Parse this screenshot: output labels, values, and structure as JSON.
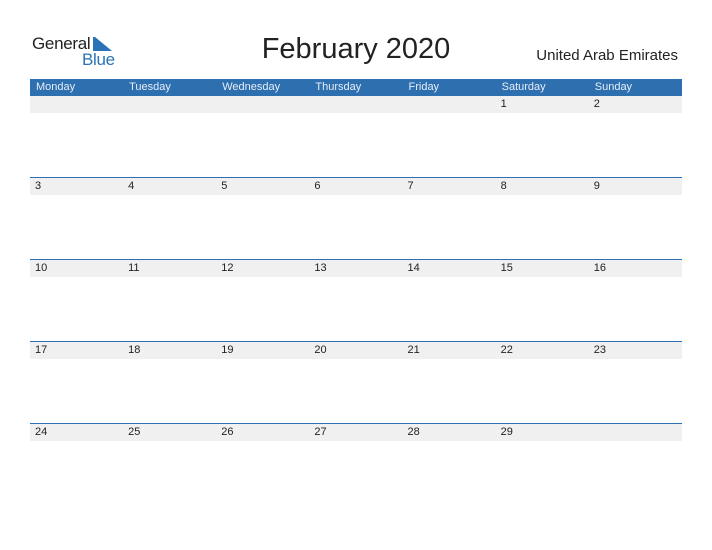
{
  "logo": {
    "general": "General",
    "blue": "Blue",
    "icon": "triangle-flag-icon"
  },
  "title": "February 2020",
  "country": "United Arab Emirates",
  "colors": {
    "accent": "#2e6fb0",
    "strip": "#f0f0f0"
  },
  "weekdays": [
    "Monday",
    "Tuesday",
    "Wednesday",
    "Thursday",
    "Friday",
    "Saturday",
    "Sunday"
  ],
  "weeks": [
    [
      "",
      "",
      "",
      "",
      "",
      "1",
      "2"
    ],
    [
      "3",
      "4",
      "5",
      "6",
      "7",
      "8",
      "9"
    ],
    [
      "10",
      "11",
      "12",
      "13",
      "14",
      "15",
      "16"
    ],
    [
      "17",
      "18",
      "19",
      "20",
      "21",
      "22",
      "23"
    ],
    [
      "24",
      "25",
      "26",
      "27",
      "28",
      "29",
      ""
    ]
  ]
}
